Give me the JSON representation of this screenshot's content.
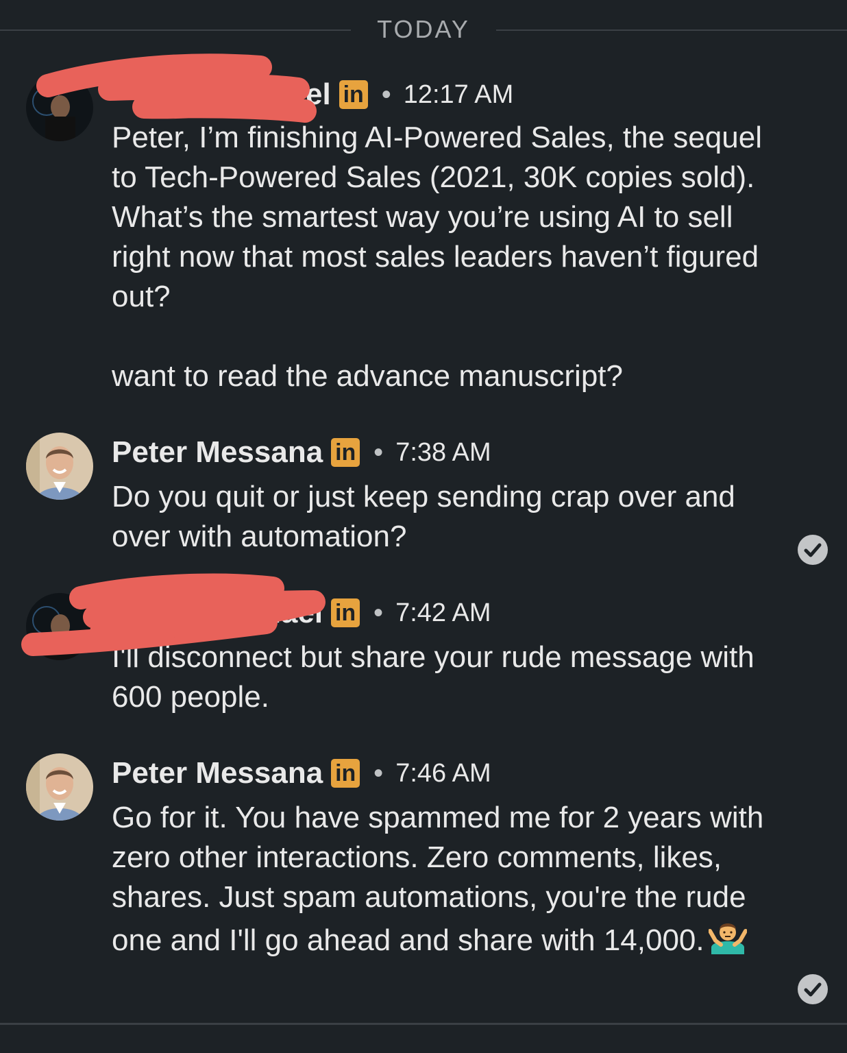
{
  "divider": {
    "label": "TODAY"
  },
  "messages": [
    {
      "sender": "el",
      "badge": "in",
      "separator": "•",
      "time": "12:17 AM",
      "paragraphs": [
        "Peter, I’m finishing AI-Powered Sales, the sequel to Tech-Powered Sales (2021, 30K copies sold). What’s the smartest way you’re using AI to sell right now that most sales leaders haven’t figured out?",
        "want to read the advance manuscript?"
      ]
    },
    {
      "sender": "Peter Messana",
      "badge": "in",
      "separator": "•",
      "time": "7:38 AM",
      "paragraphs": [
        "Do you quit or just keep sending crap over and over with automation?"
      ],
      "read": true
    },
    {
      "sender": "hael",
      "badge": "in",
      "separator": "•",
      "time": "7:42 AM",
      "paragraphs": [
        "I'll disconnect but share your rude message with 600 people."
      ]
    },
    {
      "sender": "Peter Messana",
      "badge": "in",
      "separator": "•",
      "time": "7:46 AM",
      "paragraphs": [
        "Go for it. You have spammed me for 2 years with zero other interactions. Zero comments, likes, shares. Just spam automations, you're the rude one and I'll go ahead and share with 14,000."
      ],
      "emoji": "shrug-emoji",
      "read": true
    }
  ],
  "colors": {
    "background": "#1d2226",
    "linkedin_badge": "#e7a33e",
    "redaction": "#e8625a",
    "text": "#e9e9e9"
  }
}
